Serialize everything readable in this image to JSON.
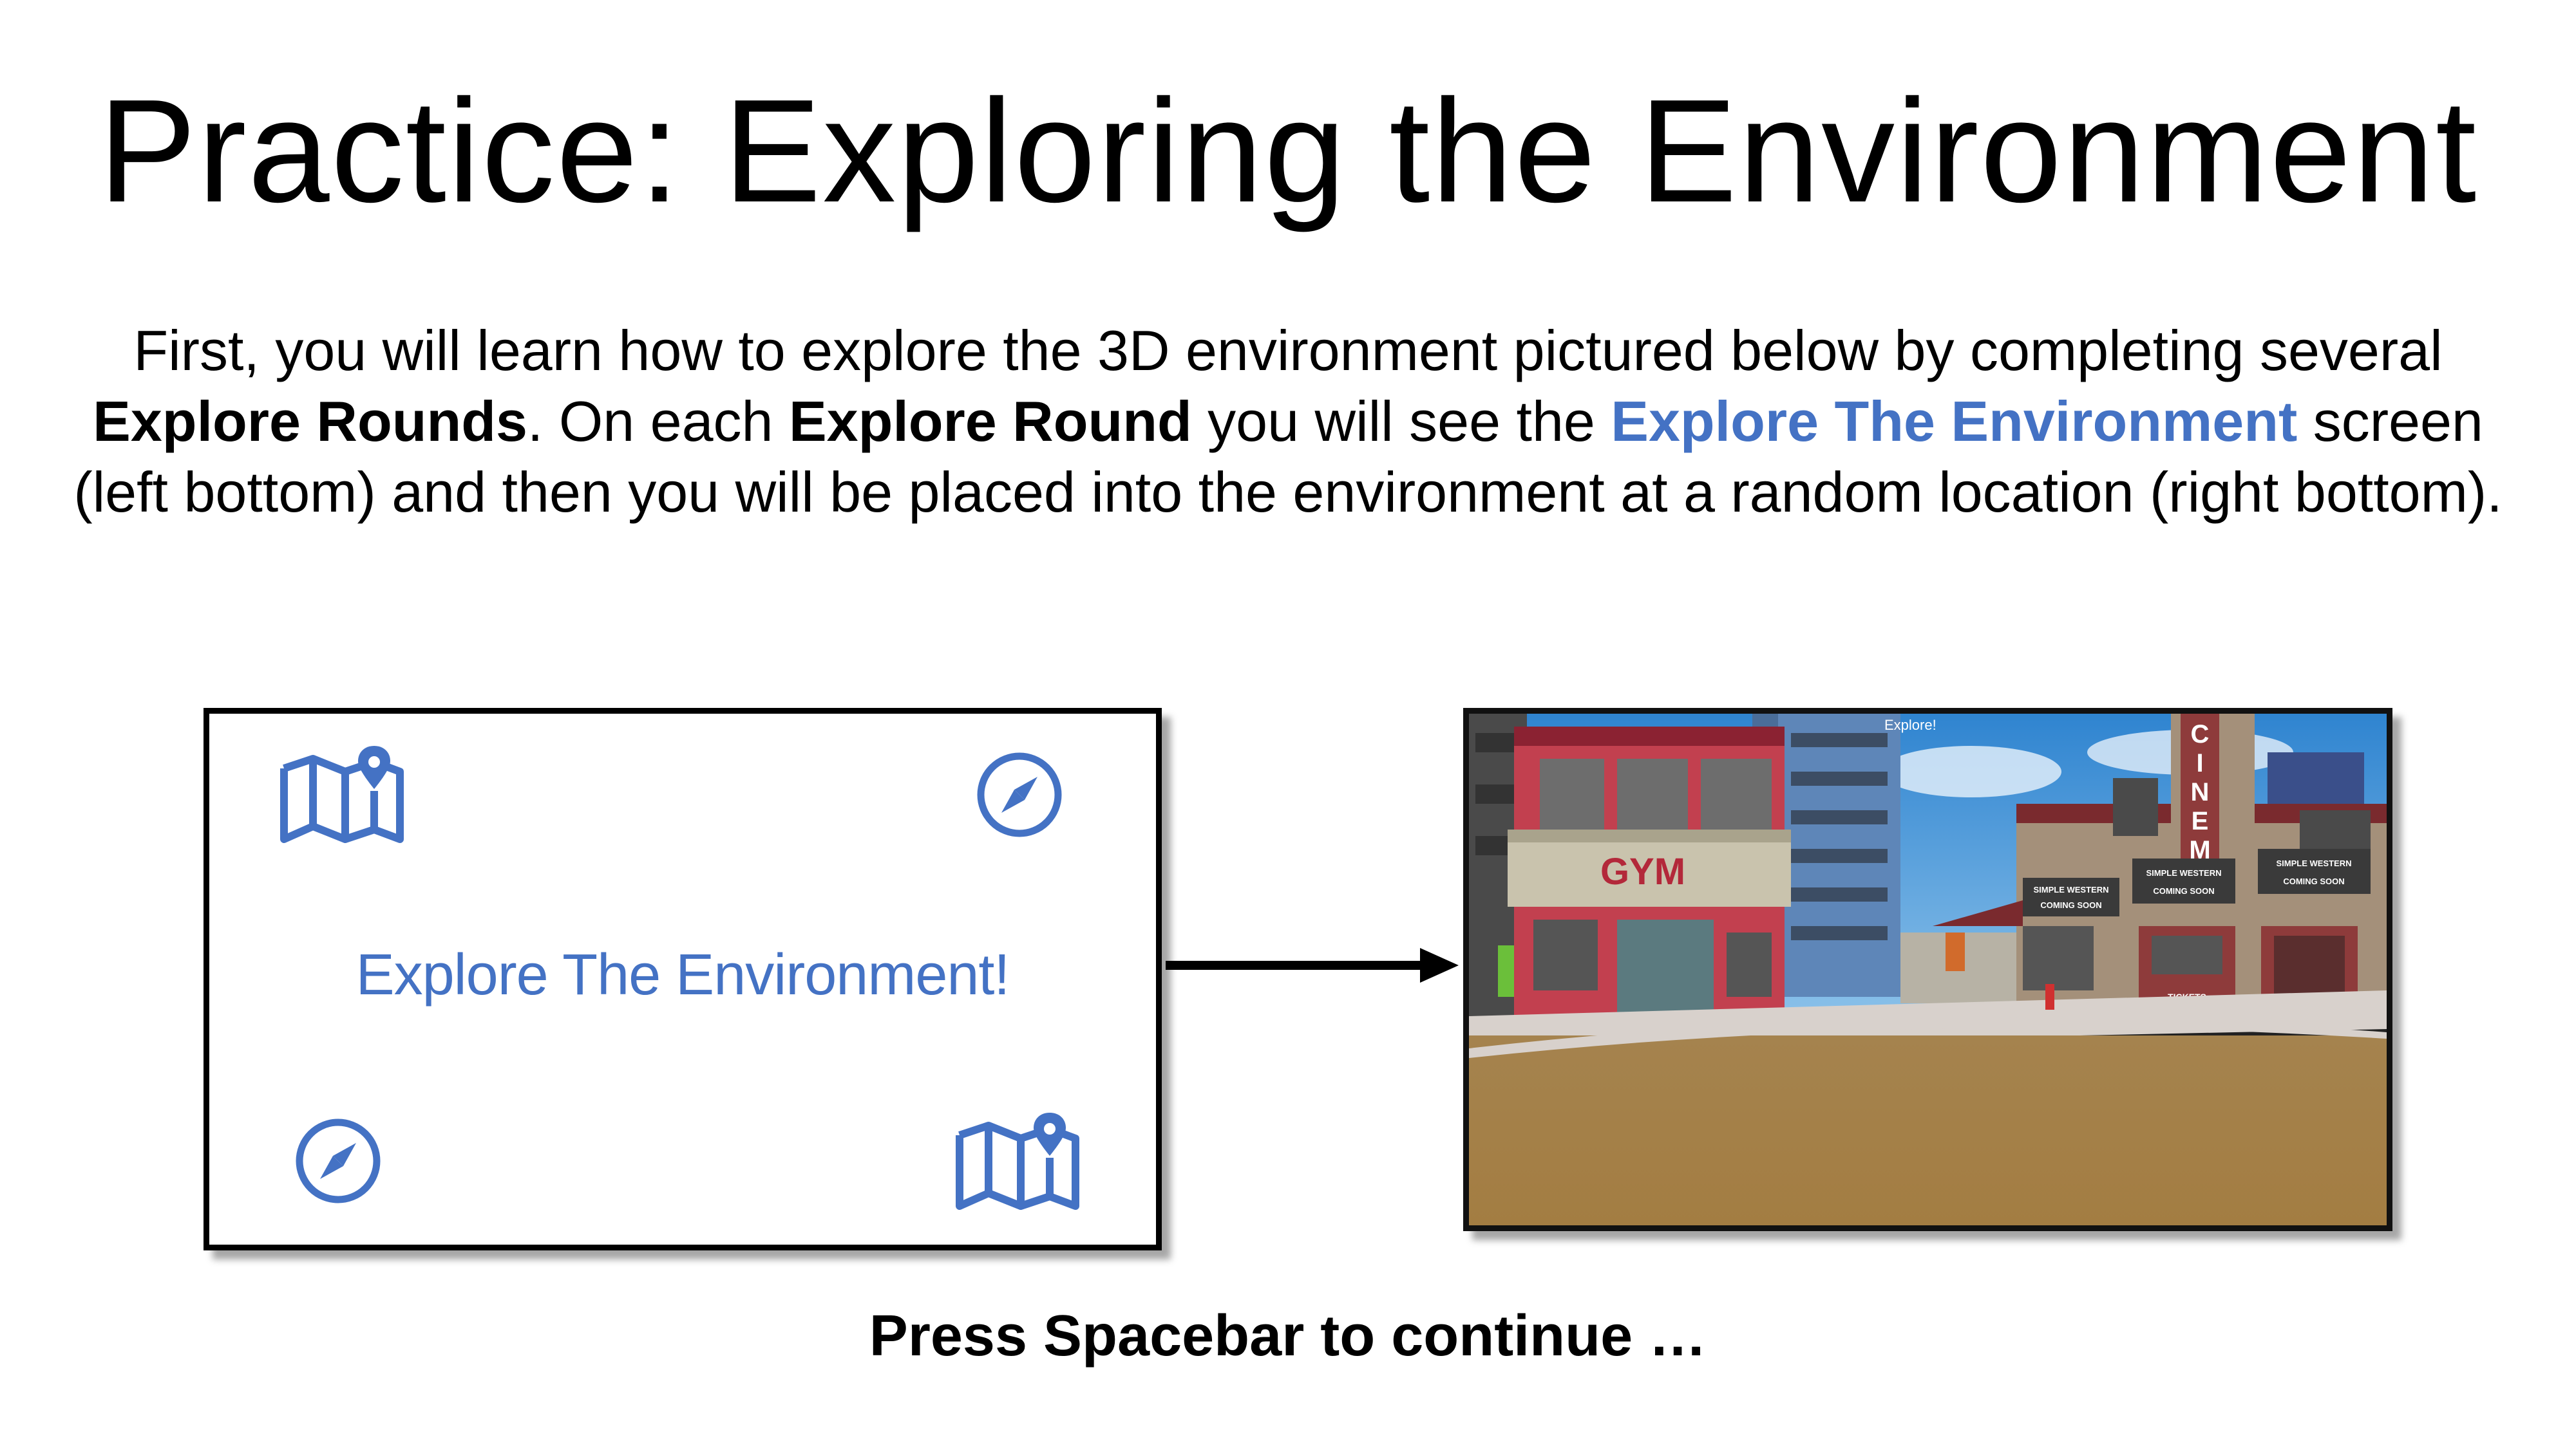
{
  "title": {
    "strong": "Practice",
    "rest": ": Exploring the Environment"
  },
  "intro": {
    "p1": "First, you will learn how to explore the 3D environment pictured below by completing several ",
    "b1": "Explore Rounds",
    "p2": ". On each ",
    "b2": "Explore Round",
    "p3": " you will see the ",
    "highlight": "Explore The Environment",
    "p4": " screen (left bottom) and then you will be placed into the environment at a random location (right bottom)."
  },
  "explore_screen": {
    "heading": "Explore The Environment!",
    "icons": [
      "map-pin-icon",
      "compass-icon",
      "compass-icon",
      "map-pin-icon"
    ]
  },
  "environment_view": {
    "top_label": "Explore!",
    "signs": {
      "gym": "GYM",
      "cinema": [
        "C",
        "I",
        "N",
        "E",
        "M"
      ],
      "marquee_1": "SIMPLE WESTERN",
      "marquee_2": "COMING SOON",
      "marquee_3": "SIMPLE WESTERN",
      "marquee_4": "COMING SOON",
      "marquee_5": "SIMPLE WESTERN",
      "marquee_6": "COMING SOON",
      "tickets": "TICKETS"
    }
  },
  "footer": "Press Spacebar to continue …",
  "colors": {
    "accent": "#4472c4",
    "text": "#000000",
    "ground": "#a8834c",
    "sky": "#3d8fd6"
  }
}
